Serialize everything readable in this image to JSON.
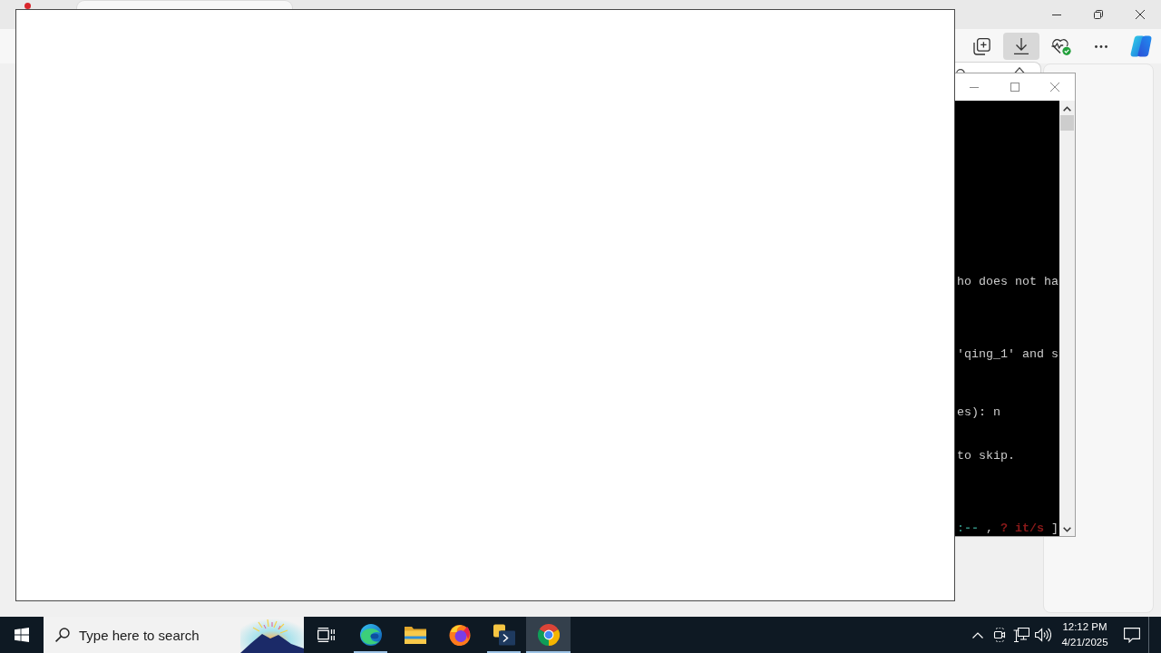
{
  "browser": {
    "toolbar_buttons": [
      {
        "kind": "collections",
        "pressed": false
      },
      {
        "kind": "downloads",
        "pressed": true
      },
      {
        "kind": "essentials",
        "pressed": false
      },
      {
        "kind": "more",
        "pressed": false
      },
      {
        "kind": "copilot",
        "pressed": false
      }
    ]
  },
  "console": {
    "lines": [
      {
        "segments": [
          {
            "text": "ho does not ha"
          }
        ]
      },
      {
        "segments": [
          {
            "text": "'qing_1' and s"
          }
        ]
      },
      {
        "segments": [
          {
            "text": "es): n"
          }
        ]
      },
      {
        "segments": [
          {
            "text": "to skip."
          }
        ]
      },
      {
        "segments": [
          {
            "text": ":--",
            "color": "#2f8a7c"
          },
          {
            "text": " , "
          },
          {
            "text": "? it/s",
            "color": "#8b1a1a"
          },
          {
            "text": " ]"
          }
        ]
      }
    ]
  },
  "taskbar": {
    "search": {
      "placeholder": "Type here to search"
    },
    "apps": [
      {
        "kind": "edge",
        "running": true,
        "selected": false
      },
      {
        "kind": "explorer",
        "running": false,
        "selected": false
      },
      {
        "kind": "firefox",
        "running": false,
        "selected": false
      },
      {
        "kind": "python",
        "running": true,
        "selected": false
      },
      {
        "kind": "chrome",
        "running": true,
        "selected": true
      }
    ],
    "clock": {
      "time": "12:12 PM",
      "date": "4/21/2025"
    }
  }
}
